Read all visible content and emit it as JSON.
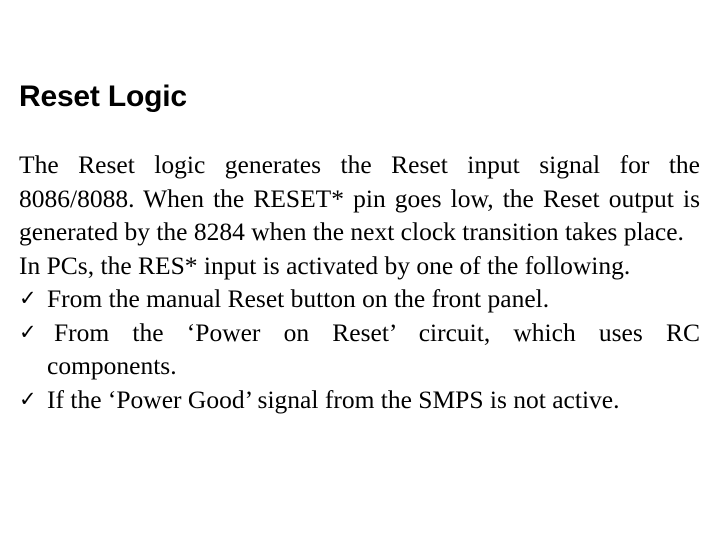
{
  "slide": {
    "title": "Reset Logic",
    "background_color": "#ffffff",
    "text_color": "#000000",
    "paragraphs": [
      "The Reset logic generates the Reset input signal for the 8086/8088. When the RESET* pin goes low, the Reset output is generated by the 8284 when the next clock transition takes place.",
      "In PCs, the RES* input is activated by one of the following."
    ],
    "bullets": {
      "marker": "✓",
      "marker_icon_name": "check-mark-icon",
      "items": [
        "From the manual Reset button on the front panel.",
        "From the ‘Power on Reset’ circuit, which uses RC components.",
        "If the ‘Power Good’ signal from the SMPS is not active."
      ]
    }
  }
}
